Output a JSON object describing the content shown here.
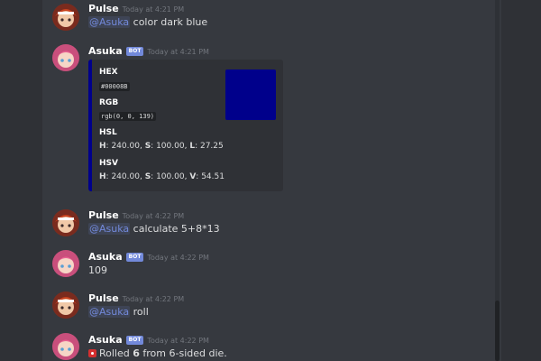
{
  "colors": {
    "background": "#36393f",
    "mention": "#7289da",
    "bot_tag": "#7289da",
    "embed_accent": "#00008b"
  },
  "messages": [
    {
      "author": "Pulse",
      "bot": false,
      "timestamp": "Today at 4:21 PM",
      "mention": "@Asuka",
      "text": "color dark blue"
    },
    {
      "author": "Asuka",
      "bot": true,
      "bot_label": "BOT",
      "timestamp": "Today at 4:21 PM",
      "embed": {
        "hex_label": "HEX",
        "hex_value": "#00008B",
        "rgb_label": "RGB",
        "rgb_value": "rgb(0, 0, 139)",
        "hsl_label": "HSL",
        "hsl_h_label": "H",
        "hsl_h": "240.00",
        "hsl_s_label": "S",
        "hsl_s": "100.00",
        "hsl_l_label": "L",
        "hsl_l": "27.25",
        "hsv_label": "HSV",
        "hsv_h_label": "H",
        "hsv_h": "240.00",
        "hsv_s_label": "S",
        "hsv_s": "100.00",
        "hsv_v_label": "V",
        "hsv_v": "54.51",
        "swatch_color": "#00008b"
      }
    },
    {
      "author": "Pulse",
      "bot": false,
      "timestamp": "Today at 4:22 PM",
      "mention": "@Asuka",
      "text": "calculate 5+8*13"
    },
    {
      "author": "Asuka",
      "bot": true,
      "bot_label": "BOT",
      "timestamp": "Today at 4:22 PM",
      "text": "109"
    },
    {
      "author": "Pulse",
      "bot": false,
      "timestamp": "Today at 4:22 PM",
      "mention": "@Asuka",
      "text": "roll"
    },
    {
      "author": "Asuka",
      "bot": true,
      "bot_label": "BOT",
      "timestamp": "Today at 4:22 PM",
      "roll": {
        "icon": "die-icon",
        "prefix": "Rolled",
        "result": "6",
        "suffix": "from 6-sided die."
      }
    }
  ]
}
